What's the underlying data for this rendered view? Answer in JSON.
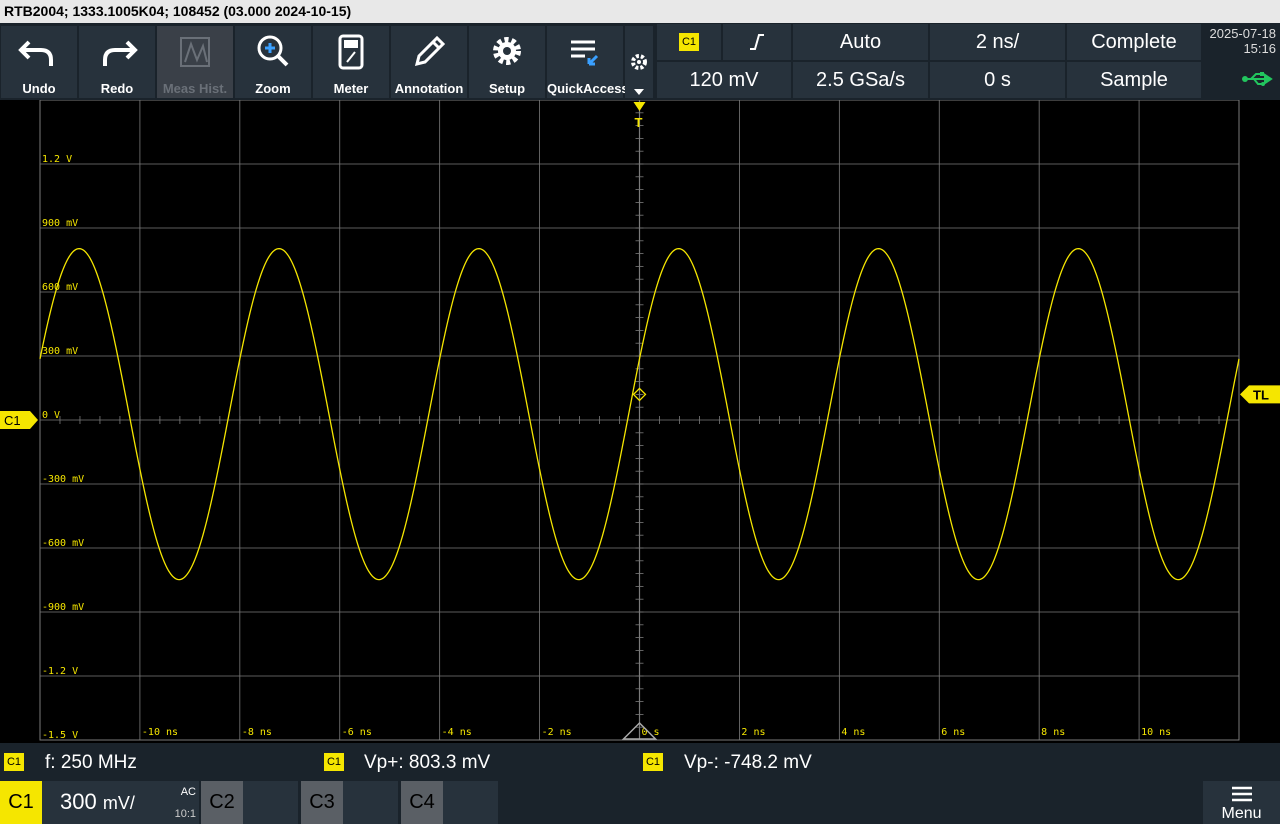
{
  "title_bar": "RTB2004; 1333.1005K04; 108452 (03.000 2024-10-15)",
  "toolbar": {
    "buttons": [
      {
        "label": "Undo",
        "icon": "undo-icon"
      },
      {
        "label": "Redo",
        "icon": "redo-icon"
      },
      {
        "label": "Meas Hist.",
        "icon": "meas-hist-icon"
      },
      {
        "label": "Zoom",
        "icon": "zoom-icon"
      },
      {
        "label": "Meter",
        "icon": "meter-icon"
      },
      {
        "label": "Annotation",
        "icon": "pencil-icon"
      },
      {
        "label": "Setup",
        "icon": "gear-icon"
      },
      {
        "label": "QuickAccess",
        "icon": "quick-access-icon"
      }
    ]
  },
  "trigger": {
    "source": "C1",
    "mode": "Auto",
    "timebase": "2 ns/",
    "acq_state": "Complete",
    "level": "120 mV",
    "sample_rate": "2.5 GSa/s",
    "position": "0 s",
    "acq_mode": "Sample"
  },
  "clock": {
    "date": "2025-07-18",
    "time": "15:16"
  },
  "y_labels": [
    "1.2 V",
    "900 mV",
    "600 mV",
    "300 mV",
    "0 V",
    "-300 mV",
    "-600 mV",
    "-900 mV",
    "-1.2 V",
    "-1.5 V"
  ],
  "x_labels": [
    "-10 ns",
    "-8 ns",
    "-6 ns",
    "-4 ns",
    "-2 ns",
    "0 s",
    "2 ns",
    "4 ns",
    "6 ns",
    "8 ns",
    "10 ns"
  ],
  "markers": {
    "channel": "C1",
    "trigger_level": "TL",
    "trigger_pos": "T"
  },
  "measurements": [
    {
      "source": "C1",
      "label": "f: 250 MHz"
    },
    {
      "source": "C1",
      "label": "Vp+: 803.3 mV"
    },
    {
      "source": "C1",
      "label": "Vp-: -748.2 mV"
    }
  ],
  "channels": {
    "c1": {
      "name": "C1",
      "scale": "300",
      "unit": "mV/",
      "coupling": "AC",
      "probe": "10:1"
    },
    "c2": {
      "name": "C2"
    },
    "c3": {
      "name": "C3"
    },
    "c4": {
      "name": "C4"
    }
  },
  "menu_label": "Menu",
  "colors": {
    "trace": "#f5e600",
    "grid": "#7a7a7a",
    "panel": "#27323c",
    "usb": "#22c55e"
  }
}
